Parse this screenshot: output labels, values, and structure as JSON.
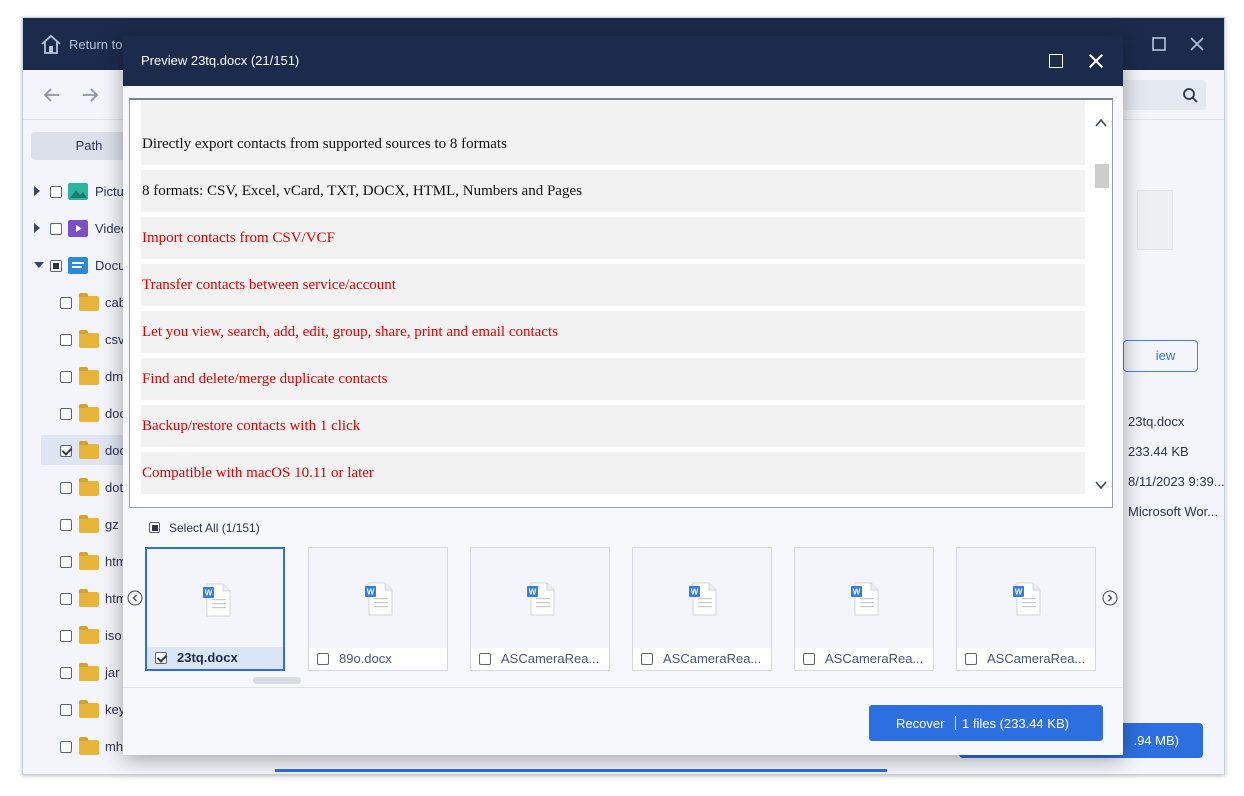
{
  "app": {
    "return_label": "Return to",
    "path_tab": "Path",
    "tree": [
      {
        "label": "Pictu",
        "expanded": false,
        "kind": "pictures"
      },
      {
        "label": "Video",
        "expanded": false,
        "kind": "videos"
      },
      {
        "label": "Docu",
        "expanded": true,
        "kind": "documents"
      }
    ],
    "folders": [
      "cab",
      "csv",
      "dm",
      "doc",
      "doc",
      "dot",
      "gz",
      "htm",
      "htm",
      "iso",
      "jar",
      "key",
      "mh"
    ],
    "preview_button": "iew",
    "file_info": {
      "name": "23tq.docx",
      "size": "233.44 KB",
      "date": "8/11/2023 9:39...",
      "type": "Microsoft Wor..."
    },
    "recover_bg": ".94 MB)"
  },
  "dialog": {
    "title": "Preview 23tq.docx (21/151)",
    "lines": [
      {
        "text": "Directly export contacts from supported sources to 8 formats",
        "color": "#111111"
      },
      {
        "text": "8 formats: CSV, Excel, vCard, TXT, DOCX, HTML, Numbers and Pages",
        "color": "#111111"
      },
      {
        "text": "Import contacts from CSV/VCF",
        "color": "#e00000"
      },
      {
        "text": "Transfer contacts between service/account",
        "color": "#e00000"
      },
      {
        "text": "Let you view, search, add, edit, group, share, print and email contacts",
        "color": "#e00000"
      },
      {
        "text": "Find and delete/merge duplicate contacts",
        "color": "#e00000"
      },
      {
        "text": "Backup/restore contacts with 1 click",
        "color": "#e00000"
      },
      {
        "text": "Compatible with macOS 10.11 or later",
        "color": "#e00000"
      }
    ],
    "select_all": "Select All (1/151)",
    "thumbnails": [
      {
        "name": "23tq.docx",
        "checked": true
      },
      {
        "name": "89o.docx",
        "checked": false
      },
      {
        "name": "ASCameraRea...",
        "checked": false
      },
      {
        "name": "ASCameraRea...",
        "checked": false
      },
      {
        "name": "ASCameraRea...",
        "checked": false
      },
      {
        "name": "ASCameraRea...",
        "checked": false
      }
    ],
    "recover_label": "Recover",
    "recover_detail": "1 files (233.44 KB)"
  },
  "colors": {
    "titlebar": "#1c2b4c",
    "accent": "#2d6fe0",
    "red_text": "#e00000"
  }
}
